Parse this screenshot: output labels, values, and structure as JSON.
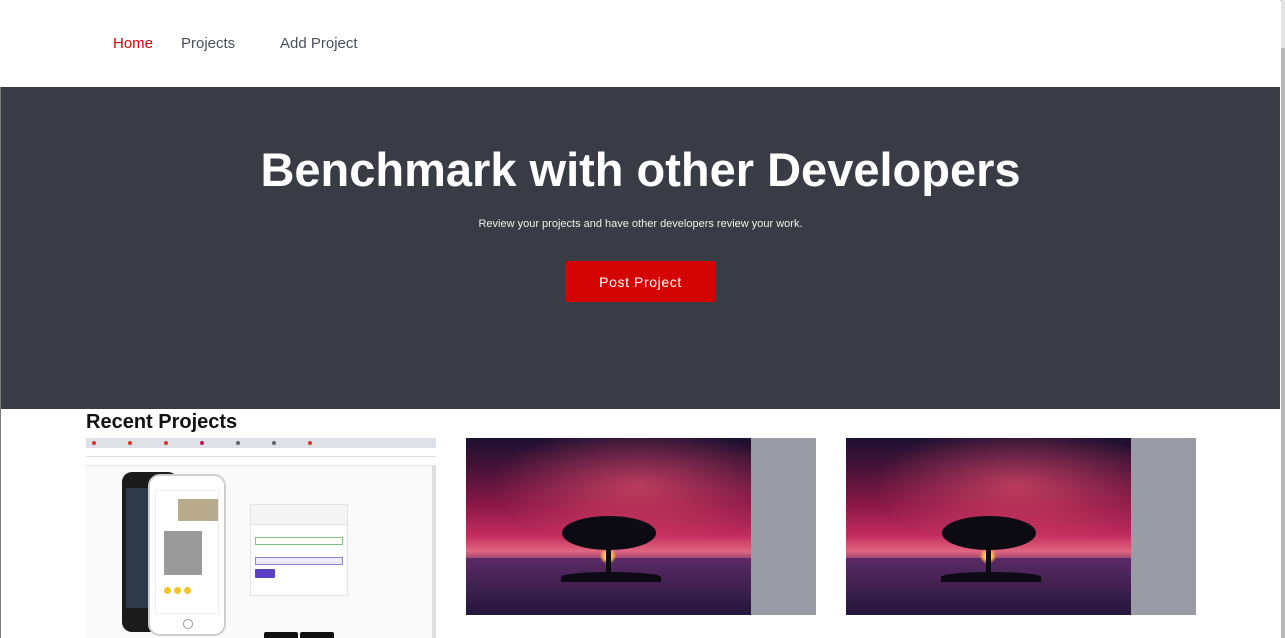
{
  "nav": {
    "home": "Home",
    "projects": "Projects",
    "add_project": "Add Project"
  },
  "hero": {
    "title": "Benchmark with other Developers",
    "subtitle": "Review your projects and have other developers review your work.",
    "cta": "Post Project"
  },
  "recent": {
    "title": "Recent Projects",
    "cards": [
      {
        "thumbnail": "instagram-clone-login-screenshot"
      },
      {
        "thumbnail": "tree-sunset-image"
      },
      {
        "thumbnail": "tree-sunset-image"
      }
    ]
  },
  "colors": {
    "accent": "#d40404",
    "hero_bg": "#393c45",
    "nav_text": "#4a4f5c",
    "card_bg": "#9a9ca5"
  }
}
